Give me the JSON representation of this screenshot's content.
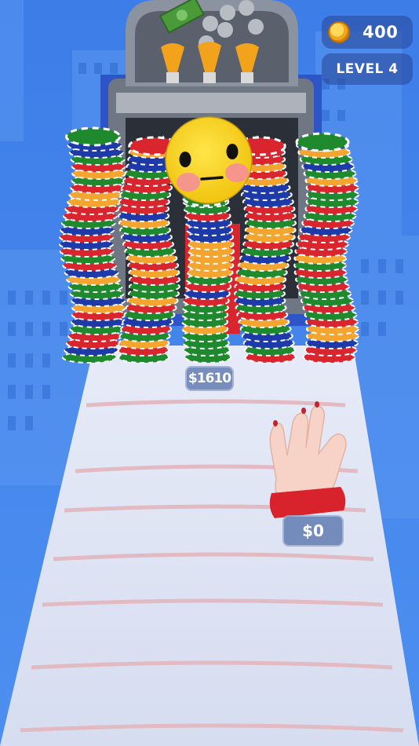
{
  "hud": {
    "coins": "400",
    "coin_icon": "coin-icon",
    "level": "LEVEL 4"
  },
  "game": {
    "stack_value": "$1610",
    "hand_value": "$0",
    "boss_face": "smiling-emoji-face",
    "machine_icon": "cash-machine"
  },
  "colors": {
    "sky": "#3f7fe8",
    "track": "#dde4f5",
    "chip_red": "#d8252e",
    "chip_green": "#1f8a2d",
    "chip_blue": "#1d3aa8",
    "chip_orange": "#f4a530",
    "face": "#fbd927"
  }
}
